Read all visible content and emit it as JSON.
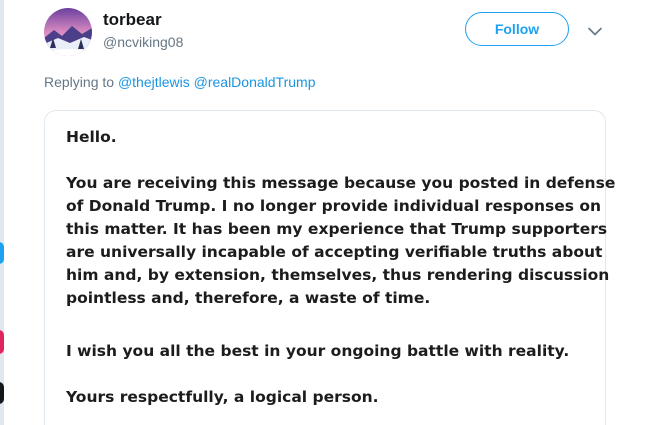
{
  "tweet": {
    "display_name": "torbear",
    "handle": "@ncviking08",
    "follow_label": "Follow",
    "more_icon": "chevron-down-icon",
    "avatar_icon": "winter-landscape-avatar"
  },
  "reply": {
    "prefix": "Replying to",
    "mentions": [
      "@thejtlewis",
      "@realDonaldTrump"
    ]
  },
  "message": {
    "greeting": "Hello.",
    "body_lines": [
      "You are receiving this message because you posted in defense",
      "of Donald Trump. I no longer provide individual responses on",
      "this matter. It has been my experience that Trump supporters",
      "are universally incapable of accepting verifiable truths about",
      "him and, by extension, themselves, thus rendering discussion",
      "pointless and, therefore, a waste of time."
    ],
    "wish": "I wish you all the best in your ongoing battle with reality.",
    "signoff": "Yours respectfully, a logical person."
  },
  "colors": {
    "accent": "#1da1f2",
    "mention": "#1b95e0",
    "muted": "#657786",
    "text": "#14171a"
  }
}
